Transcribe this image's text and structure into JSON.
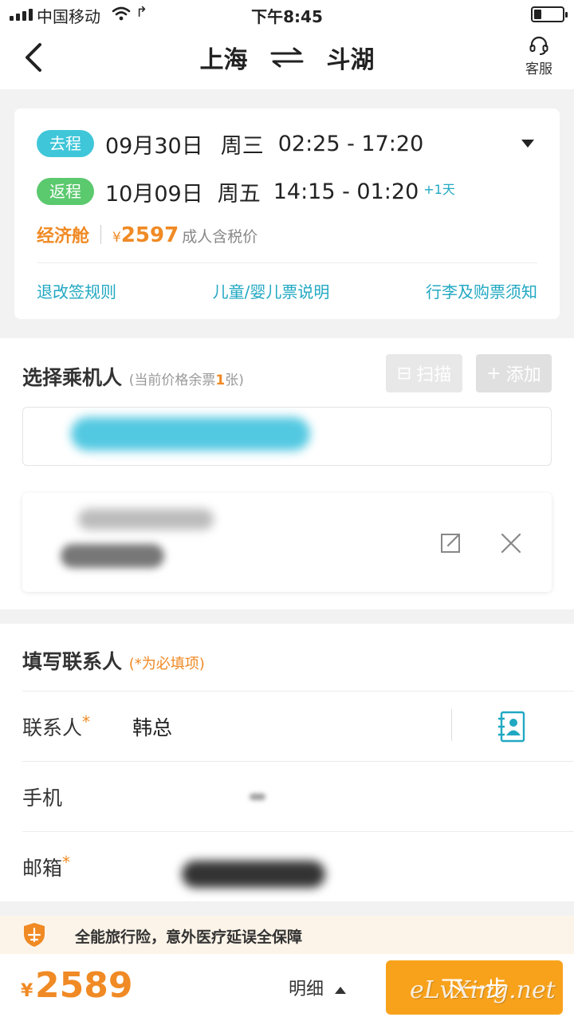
{
  "status_bar": {
    "carrier": "中国移动",
    "time": "下午8:45",
    "signal_bars": 4,
    "battery_level": 0.25
  },
  "header": {
    "origin": "上海",
    "destination": "斗湖",
    "service_label": "客服",
    "icons": [
      "back-icon",
      "swap-arrows-icon",
      "headset-icon"
    ]
  },
  "trip": {
    "outbound": {
      "tag": "去程",
      "date": "09月30日",
      "weekday": "周三",
      "times": "02:25 - 17:20"
    },
    "return": {
      "tag": "返程",
      "date": "10月09日",
      "weekday": "周五",
      "times": "14:15 - 01:20",
      "day_offset": "+1天"
    },
    "cabin": "经济舱",
    "currency": "¥",
    "price": "2597",
    "price_note": "成人含税价",
    "links": {
      "refund_rules": "退改签规则",
      "child_ticket": "儿童/婴儿票说明",
      "baggage_notice": "行李及购票须知"
    }
  },
  "passengers": {
    "title": "选择乘机人",
    "subtitle_prefix": "(当前价格余票",
    "subtitle_count": "1",
    "subtitle_suffix": "张)",
    "scan_label": "扫描",
    "add_label": "添加"
  },
  "contact": {
    "title": "填写联系人",
    "subtitle": "(*为必填项)",
    "required_mark": "*",
    "contact_label": "联系人",
    "contact_value": "韩总",
    "phone_label": "手机",
    "email_label": "邮箱"
  },
  "insurance": {
    "text": "全能旅行险，意外医疗延误全保障"
  },
  "bottom": {
    "currency": "¥",
    "total": "2589",
    "detail_label": "明细",
    "next_label": "下一步"
  },
  "watermark": "eLvXing.net",
  "colors": {
    "accent_teal": "#21a8c2",
    "outbound_tag": "#3fc6d9",
    "return_tag": "#5bc96e",
    "price_orange": "#f08a24",
    "next_button": "#f8a21c"
  }
}
